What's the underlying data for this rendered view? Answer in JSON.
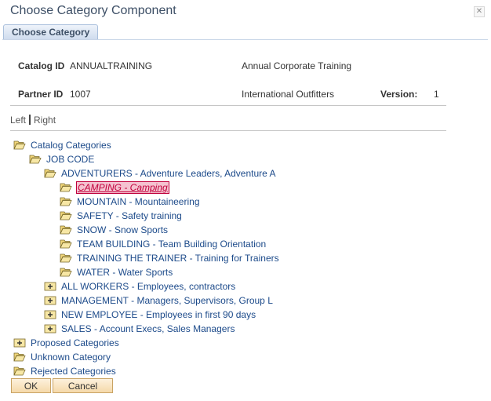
{
  "window": {
    "title": "Choose Category Component"
  },
  "tabs": [
    {
      "label": "Choose Category"
    }
  ],
  "fields": {
    "catalog_id_label": "Catalog ID",
    "catalog_id": "ANNUALTRAINING",
    "catalog_desc": "Annual Corporate Training",
    "partner_id_label": "Partner ID",
    "partner_id": "1007",
    "partner_desc": "International Outfitters",
    "version_label": "Version:",
    "version": "1"
  },
  "orientation": {
    "left": "Left",
    "right": "Right"
  },
  "tree": {
    "root": "Catalog Categories",
    "job_code": "JOB CODE",
    "adventurers": "ADVENTURERS - Adventure Leaders, Adventure A",
    "camping": "CAMPING - Camping",
    "mountain": "MOUNTAIN - Mountaineering",
    "safety": "SAFETY - Safety training",
    "snow": "SNOW - Snow Sports",
    "team_building": "TEAM BUILDING - Team Building Orientation",
    "training_trainer": "TRAINING THE TRAINER - Training for Trainers",
    "water": "WATER - Water Sports",
    "all_workers": "ALL WORKERS - Employees, contractors",
    "management": "MANAGEMENT - Managers, Supervisors, Group L",
    "new_employee": "NEW EMPLOYEE - Employees in first 90 days",
    "sales": "SALES - Account Execs, Sales Managers",
    "proposed": "Proposed Categories",
    "unknown": "Unknown Category",
    "rejected": "Rejected Categories"
  },
  "buttons": {
    "ok": "OK",
    "cancel": "Cancel"
  },
  "colors": {
    "link": "#1c4a8a",
    "selected": "#c0003c",
    "button": "#f5d9a9"
  }
}
